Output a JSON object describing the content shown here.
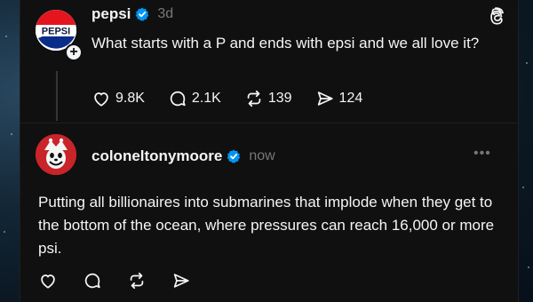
{
  "post1": {
    "avatar_alt": "PEPSI",
    "username": "pepsi",
    "time": "3d",
    "text": "What starts with a P and ends with epsi and we all love it?",
    "actions": {
      "likes": "9.8K",
      "replies": "2.1K",
      "reposts": "139",
      "shares": "124"
    }
  },
  "post2": {
    "username": "coloneltonymoore",
    "time": "now",
    "text": "Putting all billionaires into submarines that implode when they get to the bottom of the ocean, where pressures can reach 16,000 or more psi."
  },
  "icons": {
    "verified": "verified-badge-icon",
    "threads": "threads-logo-icon",
    "like": "heart-icon",
    "reply": "comment-icon",
    "repost": "repost-icon",
    "share": "send-icon",
    "more": "more-icon"
  },
  "colors": {
    "card_bg": "#101010",
    "verified_blue": "#0095f6",
    "muted": "#777777",
    "text": "#f3f5f7"
  }
}
